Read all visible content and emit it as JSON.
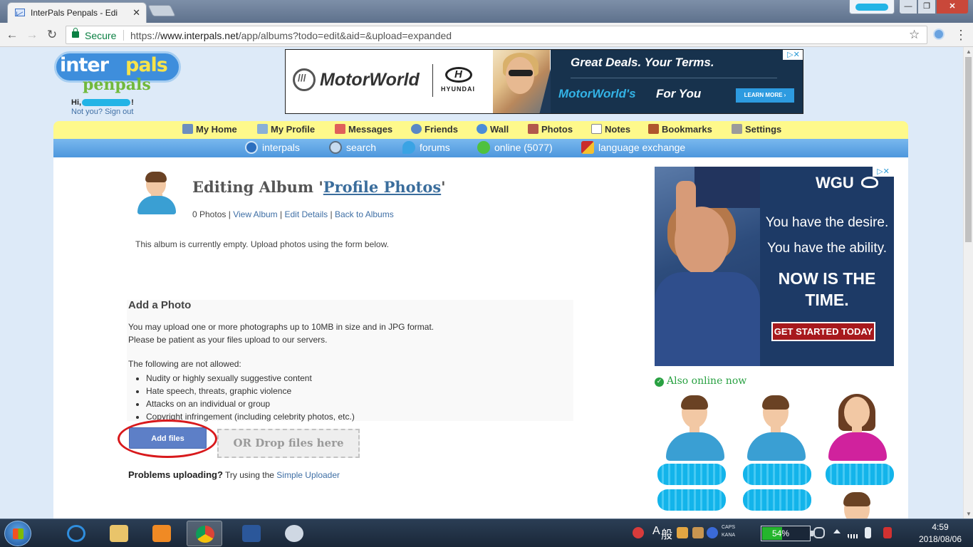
{
  "browser": {
    "tab_title": "InterPals Penpals - Edi",
    "tab_close": "✕",
    "secure_label": "Secure",
    "url_scheme": "https://",
    "url_host": "www.interpals.net",
    "url_path": "/app/albums?todo=edit&aid=&upload=expanded",
    "window_min": "—",
    "window_max": "❐",
    "window_close": "✕"
  },
  "header": {
    "logo_inter": "inter",
    "logo_pals": "pals",
    "logo_penpals": "penpals",
    "greeting_prefix": "Hi,",
    "greeting_suffix": "!",
    "signout": "Not you? Sign out"
  },
  "top_ad": {
    "brand": "MotorWorld",
    "partner": "HYUNDAI",
    "headline": "Great Deals.  Your Terms.",
    "tagline_brand": "MotorWorld's",
    "tagline_rest": "For You",
    "cta": "LEARN MORE ›",
    "adchoice": "▷✕"
  },
  "nav_primary": [
    {
      "label": "My Home",
      "icon": "home-icon",
      "color": "#6c8fbf"
    },
    {
      "label": "My Profile",
      "icon": "profile-icon",
      "color": "#8ab0d6"
    },
    {
      "label": "Messages",
      "icon": "envelope-icon",
      "color": "#e0605a"
    },
    {
      "label": "Friends",
      "icon": "friends-icon",
      "color": "#5b88c5"
    },
    {
      "label": "Wall",
      "icon": "wall-icon",
      "color": "#4b8dd8"
    },
    {
      "label": "Photos",
      "icon": "photos-icon",
      "color": "#b3584b"
    },
    {
      "label": "Notes",
      "icon": "notes-icon",
      "color": "#d5d5d5"
    },
    {
      "label": "Bookmarks",
      "icon": "bookmarks-icon",
      "color": "#b0552c"
    },
    {
      "label": "Settings",
      "icon": "settings-icon",
      "color": "#9b9b9b"
    }
  ],
  "nav_secondary": [
    {
      "label": "interpals",
      "icon": "globe-icon",
      "color": "#2c6fbf"
    },
    {
      "label": "search",
      "icon": "magnifier-icon",
      "color": "#c8dcef"
    },
    {
      "label": "forums",
      "icon": "forums-icon",
      "color": "#3aa3e4"
    },
    {
      "label": "online (5077)",
      "icon": "online-users-icon",
      "color": "#4fc13e"
    },
    {
      "label": "language exchange",
      "icon": "flags-icon",
      "color": "#c92c2c"
    }
  ],
  "album": {
    "title_prefix": "Editing Album '",
    "title_link": "Profile Photos",
    "title_suffix": "'",
    "photo_count": "0 Photos",
    "sep": "|",
    "view_album": "View Album",
    "edit_details": "Edit Details",
    "back_to_albums": "Back to Albums",
    "empty_note": "This album is currently empty. Upload photos using the form below."
  },
  "upload": {
    "heading": "Add a Photo",
    "info_line1": "You may upload one or more photographs up to 10MB in size and in JPG format.",
    "info_line2": "Please be patient as your files upload to our servers.",
    "rules_heading": "The following are not allowed:",
    "rules": [
      "Nudity or highly sexually suggestive content",
      "Hate speech, threats, graphic violence",
      "Attacks on an individual or group",
      "Copyright infringement (including celebrity photos, etc.)"
    ],
    "add_files": "Add files",
    "drop_zone": "OR Drop files here",
    "problems_bold": "Problems uploading?",
    "problems_text": "Try using the",
    "problems_link": "Simple Uploader"
  },
  "side_ad": {
    "brand": "WGU",
    "line1": "You have the desire.",
    "line2": "You have the ability.",
    "line3": "NOW IS THE TIME.",
    "cta": "GET STARTED TODAY",
    "adchoice": "▷✕"
  },
  "online_now": {
    "heading": "Also online now"
  },
  "taskbar": {
    "ime_a": "A",
    "ime_kan": "般",
    "caps": "CAPS",
    "kana": "KANA",
    "battery_label": "54%",
    "battery_level": 0.54,
    "time": "4:59",
    "date": "2018/08/06"
  }
}
